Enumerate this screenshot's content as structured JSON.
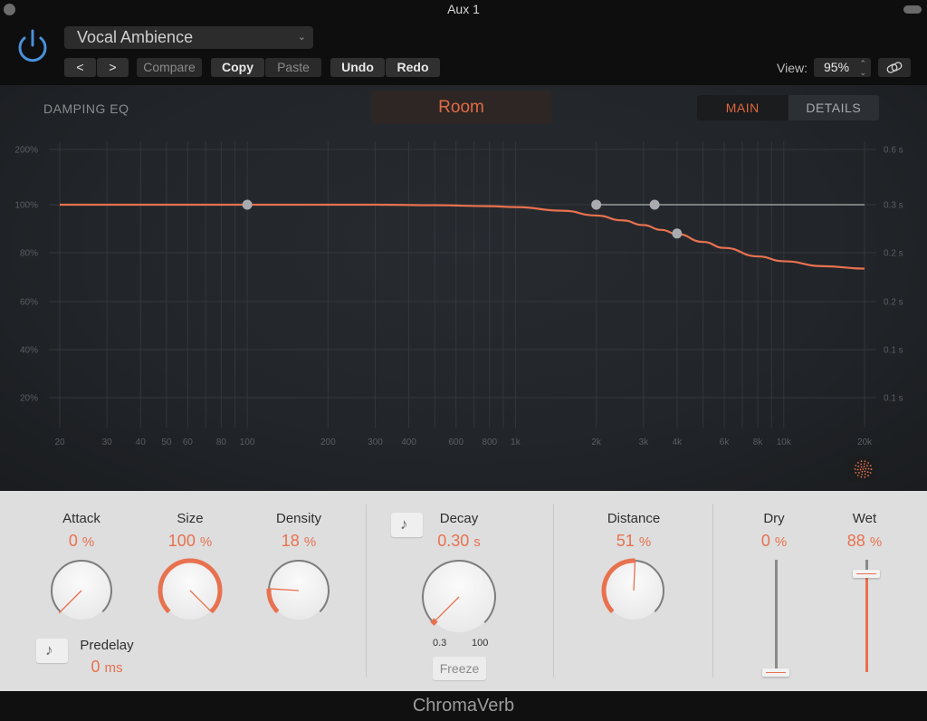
{
  "window": {
    "title": "Aux 1"
  },
  "header": {
    "preset_name": "Vocal Ambience",
    "prev_label": "<",
    "next_label": ">",
    "compare_label": "Compare",
    "copy_label": "Copy",
    "paste_label": "Paste",
    "undo_label": "Undo",
    "redo_label": "Redo",
    "view_label": "View:",
    "view_value": "95%",
    "power_color": "#4a90d9"
  },
  "graph": {
    "title": "DAMPING EQ",
    "room_label": "Room",
    "tabs": [
      {
        "label": "MAIN",
        "active": true
      },
      {
        "label": "DETAILS",
        "active": false
      }
    ],
    "accent_color": "#e8714f"
  },
  "chart_data": {
    "type": "line",
    "title": "DAMPING EQ",
    "x_scale": "log",
    "xlim": [
      20,
      20000
    ],
    "x_ticks": [
      20,
      30,
      40,
      50,
      60,
      80,
      100,
      200,
      300,
      400,
      600,
      800,
      1000,
      2000,
      3000,
      4000,
      6000,
      8000,
      10000,
      20000
    ],
    "x_tick_labels": [
      "20",
      "30",
      "40",
      "50",
      "60",
      "80",
      "100",
      "200",
      "300",
      "400",
      "600",
      "800",
      "1k",
      "2k",
      "3k",
      "4k",
      "6k",
      "8k",
      "10k",
      "20k"
    ],
    "x_minor_gridlines": [
      70,
      90,
      500,
      700,
      900,
      5000,
      7000,
      9000
    ],
    "y_ticks_left": [
      200,
      100,
      80,
      60,
      40,
      20
    ],
    "y_tick_labels_left": [
      "200%",
      "100%",
      "80%",
      "60%",
      "40%",
      "20%"
    ],
    "y_tick_labels_right": [
      "0.6 s",
      "0.3 s",
      "0.2 s",
      "0.2 s",
      "0.1 s",
      "0.1 s"
    ],
    "grid": true,
    "series": [
      {
        "name": "damping curve",
        "color": "#e8714f",
        "x": [
          20,
          100,
          300,
          500,
          800,
          1000,
          1500,
          2000,
          2500,
          3000,
          3500,
          4000,
          5000,
          6000,
          8000,
          10000,
          14000,
          20000
        ],
        "y": [
          100,
          100,
          100,
          99.8,
          99.4,
          99,
          97.5,
          95.5,
          93.5,
          91.5,
          89.5,
          87.8,
          84.5,
          82,
          78.5,
          76.5,
          74.5,
          73.5
        ]
      },
      {
        "name": "reference line",
        "color": "#9a9a9a",
        "x": [
          2000,
          20000
        ],
        "y": [
          100,
          100
        ]
      }
    ],
    "control_points": [
      {
        "x": 100,
        "y": 100
      },
      {
        "x": 2000,
        "y": 100
      },
      {
        "x": 3300,
        "y": 100
      },
      {
        "x": 4000,
        "y": 88
      }
    ]
  },
  "controls": {
    "attack": {
      "label": "Attack",
      "value": "0",
      "unit": "%",
      "fraction": 0.0
    },
    "size": {
      "label": "Size",
      "value": "100",
      "unit": "%",
      "fraction": 1.0
    },
    "density": {
      "label": "Density",
      "value": "18",
      "unit": "%",
      "fraction": 0.18
    },
    "predelay": {
      "label": "Predelay",
      "value": "0",
      "unit": "ms"
    },
    "decay": {
      "label": "Decay",
      "value": "0.30",
      "unit": "s",
      "fraction": 0.0,
      "min_label": "0.3",
      "max_label": "100",
      "freeze_label": "Freeze"
    },
    "distance": {
      "label": "Distance",
      "value": "51",
      "unit": "%",
      "fraction": 0.51
    },
    "dry": {
      "label": "Dry",
      "value": "0",
      "unit": "%",
      "fraction": 0.0
    },
    "wet": {
      "label": "Wet",
      "value": "88",
      "unit": "%",
      "fraction": 0.88
    }
  },
  "footer": {
    "plugin_name": "ChromaVerb"
  }
}
